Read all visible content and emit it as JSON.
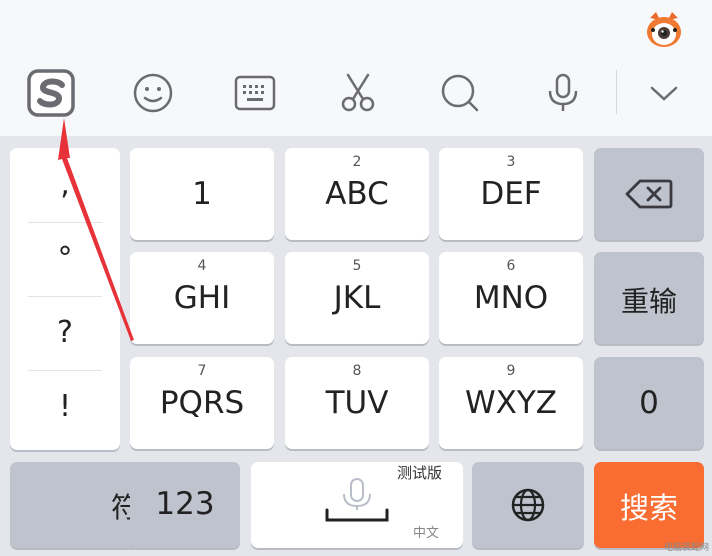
{
  "toolbar": {
    "icons": [
      "sogou-logo-icon",
      "emoji-icon",
      "keyboard-icon",
      "scissors-icon",
      "search-icon",
      "microphone-icon",
      "chevron-down-icon"
    ]
  },
  "punctuation": [
    ",",
    "°",
    "?",
    "!"
  ],
  "keys": {
    "k1": {
      "main": "1"
    },
    "k2": {
      "num": "2",
      "main": "ABC"
    },
    "k3": {
      "num": "3",
      "main": "DEF"
    },
    "k4": {
      "num": "4",
      "main": "GHI"
    },
    "k5": {
      "num": "5",
      "main": "JKL"
    },
    "k6": {
      "num": "6",
      "main": "MNO"
    },
    "k7": {
      "num": "7",
      "main": "PQRS"
    },
    "k8": {
      "num": "8",
      "main": "TUV"
    },
    "k9": {
      "num": "9",
      "main": "WXYZ"
    },
    "retype": "重输",
    "zero": "0",
    "symbols": "符",
    "num123": "123",
    "space_badge": "测试版",
    "space_lang": "中文",
    "search": "搜索"
  },
  "colors": {
    "accent": "#f96c32",
    "gray_key": "#bec3cd",
    "arrow": "#e8323a"
  },
  "watermark": "电脑装配网"
}
